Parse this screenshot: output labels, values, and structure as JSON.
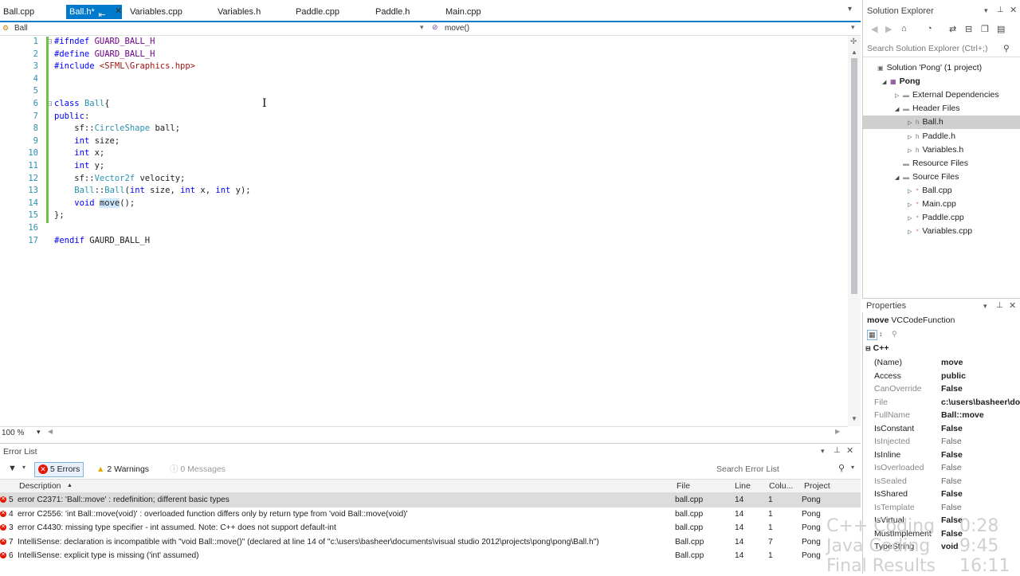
{
  "tabs": [
    {
      "label": "Ball.cpp",
      "active": false
    },
    {
      "label": "Ball.h*",
      "active": true
    },
    {
      "label": "Variables.cpp",
      "active": false
    },
    {
      "label": "Variables.h",
      "active": false
    },
    {
      "label": "Paddle.cpp",
      "active": false
    },
    {
      "label": "Paddle.h",
      "active": false
    },
    {
      "label": "Main.cpp",
      "active": false
    }
  ],
  "nav": {
    "scope": "Ball",
    "member": "move()"
  },
  "zoom": "100 %",
  "code_lines": [
    {
      "n": "1",
      "text": "#ifndef GUARD_BALL_H"
    },
    {
      "n": "2",
      "text": "#define GUARD_BALL_H"
    },
    {
      "n": "3",
      "text": "#include <SFML\\Graphics.hpp>"
    },
    {
      "n": "4",
      "text": ""
    },
    {
      "n": "5",
      "text": ""
    },
    {
      "n": "6",
      "text": "class Ball{"
    },
    {
      "n": "7",
      "text": "public:"
    },
    {
      "n": "8",
      "text": "    sf::CircleShape ball;"
    },
    {
      "n": "9",
      "text": "    int size;"
    },
    {
      "n": "10",
      "text": "    int x;"
    },
    {
      "n": "11",
      "text": "    int y;"
    },
    {
      "n": "12",
      "text": "    sf::Vector2f velocity;"
    },
    {
      "n": "13",
      "text": "    Ball::Ball(int size, int x, int y);"
    },
    {
      "n": "14",
      "text": "    void move();"
    },
    {
      "n": "15",
      "text": "};"
    },
    {
      "n": "16",
      "text": ""
    },
    {
      "n": "17",
      "text": "#endif GAURD_BALL_H"
    }
  ],
  "error_list": {
    "title": "Error List",
    "errors_label": "5 Errors",
    "warnings_label": "2 Warnings",
    "messages_label": "0 Messages",
    "search_placeholder": "Search Error List",
    "columns": [
      "Description",
      "File",
      "Line",
      "Colu...",
      "Project"
    ],
    "rows": [
      {
        "num": "5",
        "desc": "error C2371: 'Ball::move' : redefinition; different basic types",
        "file": "ball.cpp",
        "line": "14",
        "col": "1",
        "project": "Pong"
      },
      {
        "num": "4",
        "desc": "error C2556: 'int Ball::move(void)' : overloaded function differs only by return type from 'void Ball::move(void)'",
        "file": "ball.cpp",
        "line": "14",
        "col": "1",
        "project": "Pong"
      },
      {
        "num": "3",
        "desc": "error C4430: missing type specifier - int assumed. Note: C++ does not support default-int",
        "file": "ball.cpp",
        "line": "14",
        "col": "1",
        "project": "Pong"
      },
      {
        "num": "7",
        "desc": "IntelliSense: declaration is incompatible with \"void Ball::move()\" (declared at line 14 of \"c:\\users\\basheer\\documents\\visual studio 2012\\projects\\pong\\pong\\Ball.h\")",
        "file": "Ball.cpp",
        "line": "14",
        "col": "7",
        "project": "Pong"
      },
      {
        "num": "6",
        "desc": "IntelliSense: explicit type is missing ('int' assumed)",
        "file": "Ball.cpp",
        "line": "14",
        "col": "1",
        "project": "Pong"
      }
    ]
  },
  "solution_explorer": {
    "title": "Solution Explorer",
    "search_placeholder": "Search Solution Explorer (Ctrl+;)",
    "nodes": [
      {
        "label": "Solution 'Pong' (1 project)",
        "depth": 0,
        "tri": ""
      },
      {
        "label": "Pong",
        "depth": 1,
        "tri": "◢",
        "bold": true
      },
      {
        "label": "External Dependencies",
        "depth": 2,
        "tri": "▷"
      },
      {
        "label": "Header Files",
        "depth": 2,
        "tri": "◢"
      },
      {
        "label": "Ball.h",
        "depth": 3,
        "tri": "▷",
        "selected": true
      },
      {
        "label": "Paddle.h",
        "depth": 3,
        "tri": "▷"
      },
      {
        "label": "Variables.h",
        "depth": 3,
        "tri": "▷"
      },
      {
        "label": "Resource Files",
        "depth": 2,
        "tri": ""
      },
      {
        "label": "Source Files",
        "depth": 2,
        "tri": "◢"
      },
      {
        "label": "Ball.cpp",
        "depth": 3,
        "tri": "▷"
      },
      {
        "label": "Main.cpp",
        "depth": 3,
        "tri": "▷"
      },
      {
        "label": "Paddle.cpp",
        "depth": 3,
        "tri": "▷"
      },
      {
        "label": "Variables.cpp",
        "depth": 3,
        "tri": "▷"
      }
    ]
  },
  "properties": {
    "title": "Properties",
    "object_name": "move",
    "object_type": "VCCodeFunction",
    "category": "C++",
    "rows": [
      {
        "name": "(Name)",
        "value": "move",
        "dim": false
      },
      {
        "name": "Access",
        "value": "public",
        "dim": false
      },
      {
        "name": "CanOverride",
        "value": "False",
        "dim": true
      },
      {
        "name": "File",
        "value": "c:\\users\\basheer\\do",
        "dim": true
      },
      {
        "name": "FullName",
        "value": "Ball::move",
        "dim": true
      },
      {
        "name": "IsConstant",
        "value": "False",
        "dim": false
      },
      {
        "name": "IsInjected",
        "value": "False",
        "dim": true
      },
      {
        "name": "IsInline",
        "value": "False",
        "dim": false
      },
      {
        "name": "IsOverloaded",
        "value": "False",
        "dim": true
      },
      {
        "name": "IsSealed",
        "value": "False",
        "dim": true
      },
      {
        "name": "IsShared",
        "value": "False",
        "dim": false
      },
      {
        "name": "IsTemplate",
        "value": "False",
        "dim": true
      },
      {
        "name": "IsVirtual",
        "value": "False",
        "dim": false
      },
      {
        "name": "MustImplement",
        "value": "False",
        "dim": false
      },
      {
        "name": "TypeString",
        "value": "void",
        "dim": false
      }
    ]
  },
  "overlay": [
    {
      "label": "C++ Coding",
      "time": "0:28"
    },
    {
      "label": "Java Coding",
      "time": "9:45"
    },
    {
      "label": "Final Results",
      "time": "16:11"
    }
  ]
}
